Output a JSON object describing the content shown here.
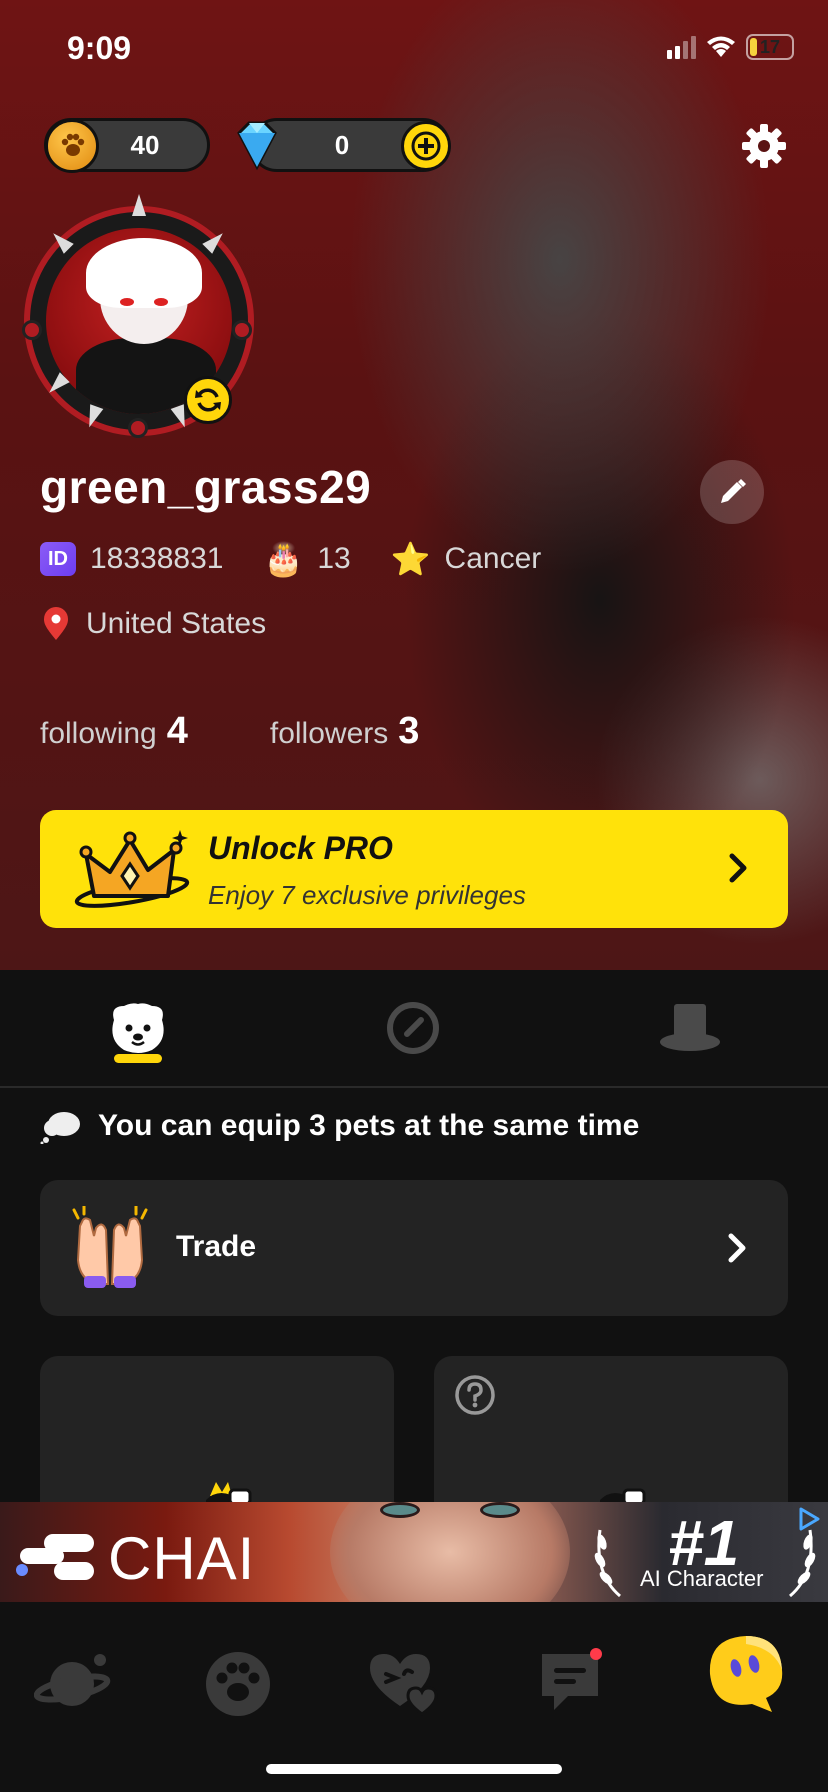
{
  "status_bar": {
    "time": "9:09",
    "battery": "17"
  },
  "currency": {
    "coins": "40",
    "gems": "0"
  },
  "profile": {
    "username": "green_grass29",
    "id_badge": "ID",
    "id": "18338831",
    "age": "13",
    "zodiac": "Cancer",
    "location": "United States",
    "following_label": "following",
    "following_count": "4",
    "followers_label": "followers",
    "followers_count": "3"
  },
  "pro_banner": {
    "title": "Unlock PRO",
    "subtitle": "Enjoy 7 exclusive privileges"
  },
  "tabs": [
    {
      "name": "pets",
      "icon": "dog-face-icon",
      "active": true
    },
    {
      "name": "explore",
      "icon": "compass-icon",
      "active": false
    },
    {
      "name": "outfits",
      "icon": "top-hat-icon",
      "active": false
    }
  ],
  "pets": {
    "tip": "You can equip 3 pets at the same time",
    "trade_label": "Trade"
  },
  "ad": {
    "brand": "CHAI",
    "rank": "#1",
    "caption": "AI Character"
  },
  "bottom_nav": [
    {
      "name": "planet",
      "icon": "planet-icon"
    },
    {
      "name": "pets",
      "icon": "paw-icon"
    },
    {
      "name": "match",
      "icon": "hearts-icon"
    },
    {
      "name": "chat",
      "icon": "chat-icon",
      "notification": true
    },
    {
      "name": "profile",
      "icon": "ghost-avatar-icon",
      "active": true
    }
  ],
  "colors": {
    "accent": "#ffe20a",
    "background": "#111111",
    "card": "#232323",
    "hero": "#6f1414"
  }
}
